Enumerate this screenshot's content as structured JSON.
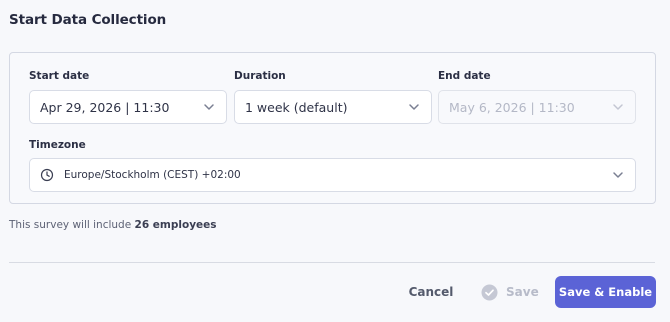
{
  "header": {
    "title": "Start Data Collection"
  },
  "form": {
    "start_date": {
      "label": "Start date",
      "value": "Apr 29, 2026 | 11:30"
    },
    "duration": {
      "label": "Duration",
      "value": "1 week (default)"
    },
    "end_date": {
      "label": "End date",
      "value": "May 6, 2026 | 11:30",
      "disabled": true
    },
    "timezone": {
      "label": "Timezone",
      "value": "Europe/Stockholm (CEST) +02:00",
      "icon": "clock-icon"
    }
  },
  "note": {
    "prefix": "This survey will include ",
    "count_text": "26 employees"
  },
  "actions": {
    "cancel_label": "Cancel",
    "save_label": "Save",
    "save_enable_label": "Save & Enable"
  },
  "colors": {
    "primary": "#5b63d6",
    "disabled_text": "#b4b8c6",
    "border": "#d8dce6"
  }
}
